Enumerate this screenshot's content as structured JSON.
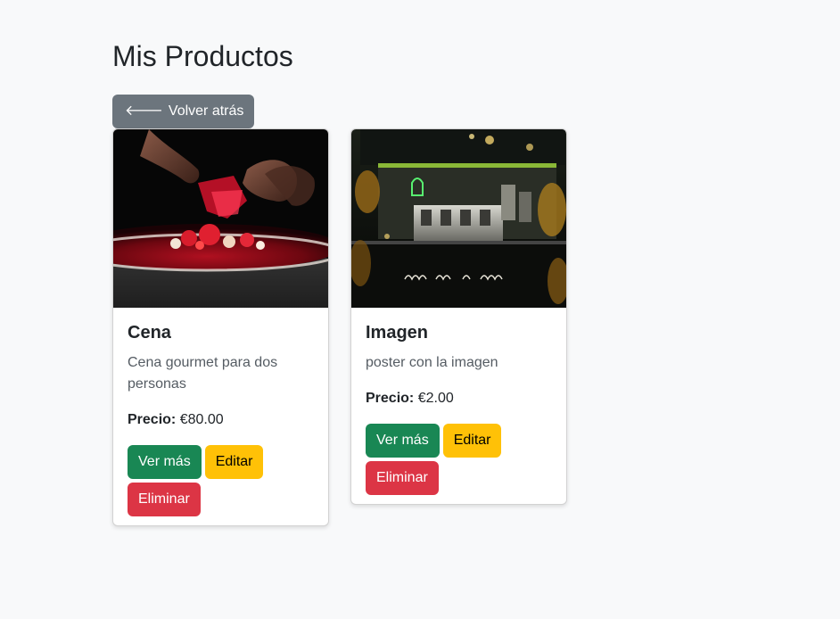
{
  "page": {
    "title": "Mis Productos",
    "back_button": "Volver atrás"
  },
  "products": [
    {
      "title": "Cena",
      "description": "Cena gourmet para dos personas",
      "price_label": "Precio:",
      "price_value": "€80.00",
      "image_alt": "dessert-plate-photo",
      "buttons": {
        "view": "Ver más",
        "edit": "Editar",
        "delete": "Eliminar"
      }
    },
    {
      "title": "Imagen",
      "description": "poster con la imagen",
      "price_label": "Precio:",
      "price_value": "€2.00",
      "image_alt": "coffee-cart-photo",
      "buttons": {
        "view": "Ver más",
        "edit": "Editar",
        "delete": "Eliminar"
      }
    }
  ],
  "colors": {
    "background": "#f8f9fa",
    "secondary": "#6c757d",
    "success": "#198754",
    "warning": "#ffc107",
    "danger": "#dc3545"
  }
}
